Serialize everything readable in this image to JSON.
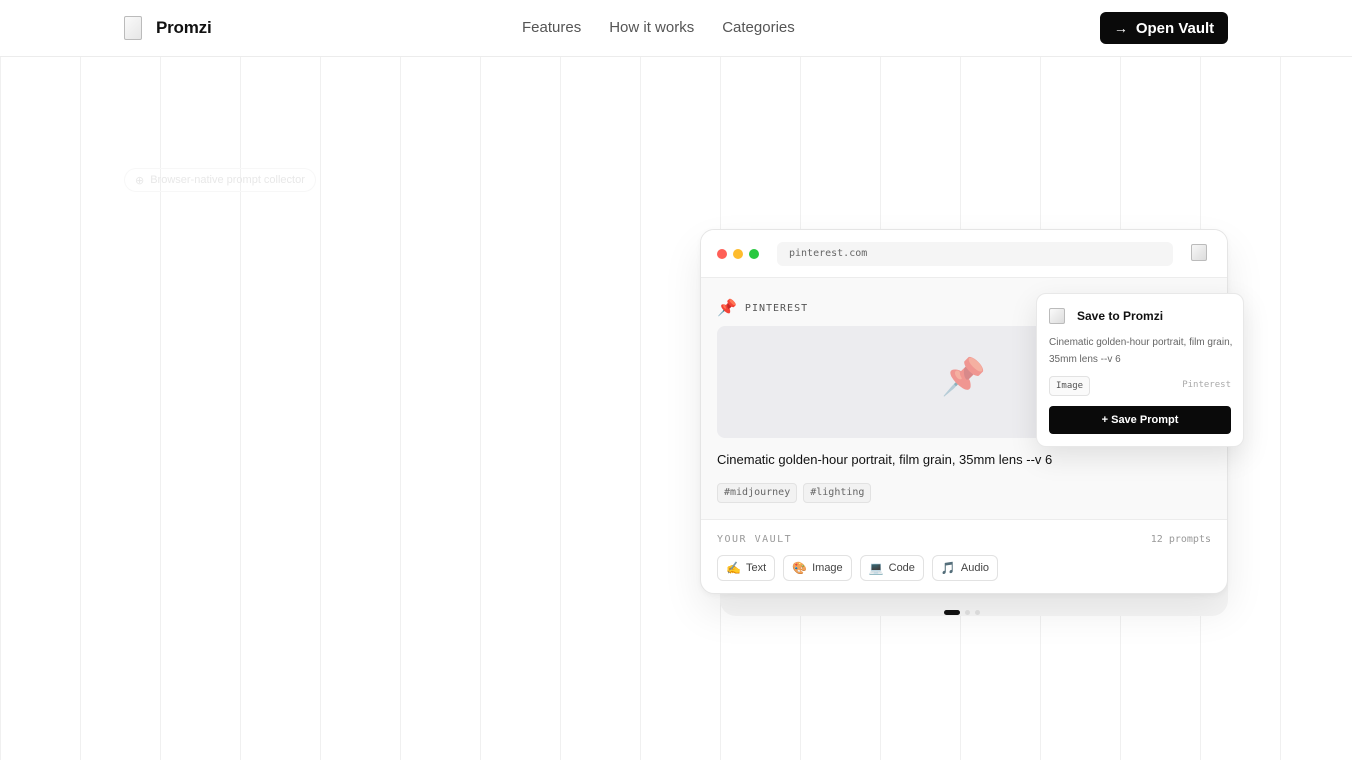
{
  "nav": {
    "brand": "Promzi",
    "links": [
      "Features",
      "How it works",
      "Categories"
    ],
    "cta_label": "Open Vault"
  },
  "hero": {
    "badge": "Browser-native prompt collector"
  },
  "browser": {
    "url": "pinterest.com",
    "site_icon": "pushpin-icon",
    "site_label": "PINTEREST",
    "prompt": "Cinematic golden-hour portrait, film grain, 35mm lens --v 6",
    "tags": [
      "#midjourney",
      "#lighting"
    ],
    "vault_label": "YOUR VAULT",
    "vault_count": "12 prompts",
    "categories": [
      {
        "icon": "✍️",
        "label": "Text"
      },
      {
        "icon": "🎨",
        "label": "Image"
      },
      {
        "icon": "💻",
        "label": "Code"
      },
      {
        "icon": "🎵",
        "label": "Audio"
      }
    ],
    "traffic_colors": [
      "#ff5f57",
      "#febc2e",
      "#28c840"
    ]
  },
  "popup": {
    "title": "Save to Promzi",
    "description": "Cinematic golden-hour portrait, film grain, 35mm lens --v 6",
    "type": "Image",
    "source": "Pinterest",
    "button": "+ Save Prompt"
  },
  "carousel": {
    "active_index": 0,
    "count": 3
  }
}
